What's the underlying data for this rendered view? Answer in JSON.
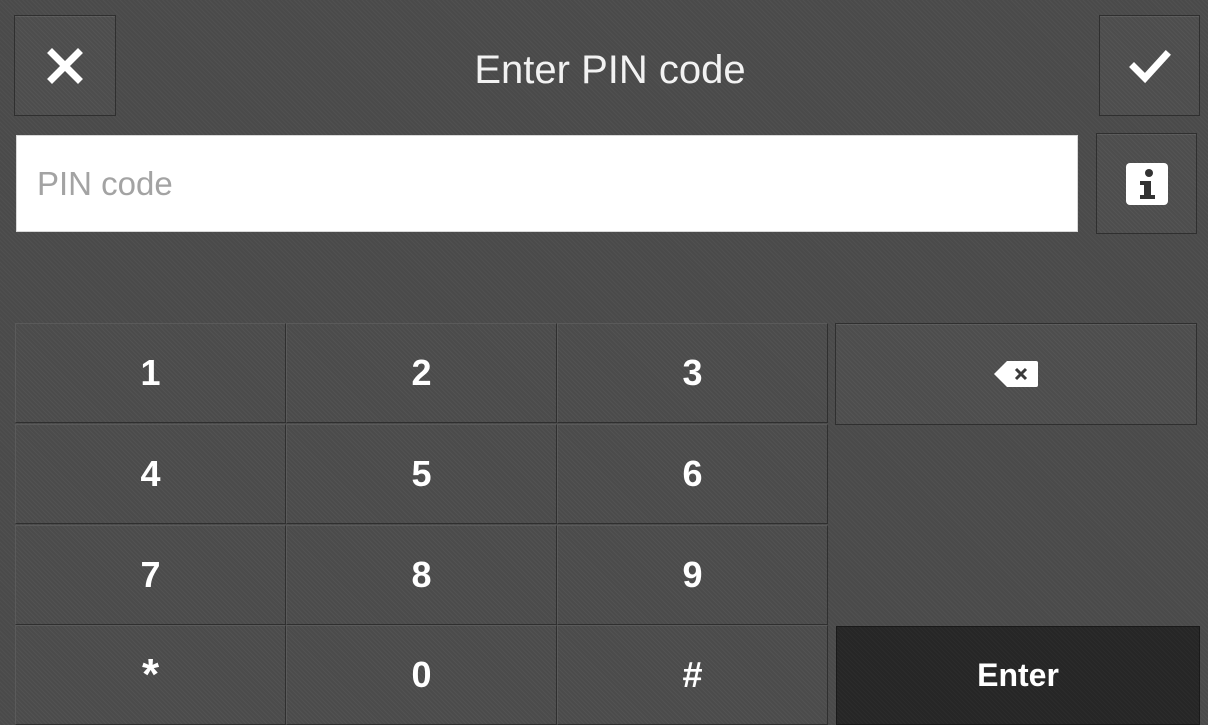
{
  "header": {
    "title": "Enter PIN code",
    "cancel_icon": "close-icon",
    "confirm_icon": "checkmark-icon"
  },
  "pin_field": {
    "placeholder": "PIN code",
    "value": "",
    "info_icon": "info-icon"
  },
  "keypad": {
    "keys": [
      "1",
      "2",
      "3",
      "4",
      "5",
      "6",
      "7",
      "8",
      "9",
      "*",
      "0",
      "#"
    ],
    "backspace_icon": "backspace-icon",
    "enter_label": "Enter"
  },
  "colors": {
    "background": "#4a4a4a",
    "enter_background": "#262626",
    "input_background": "#ffffff",
    "text": "#ffffff",
    "placeholder": "#a3a3a3"
  }
}
